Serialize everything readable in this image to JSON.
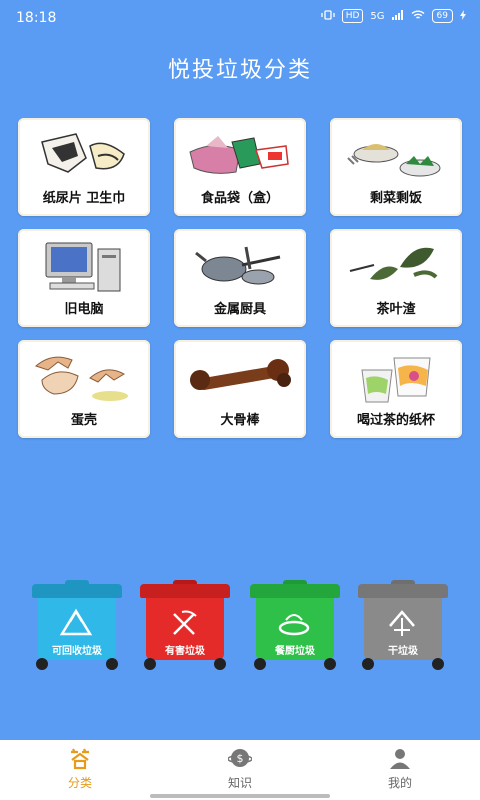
{
  "status_bar": {
    "time": "18:18",
    "network_badge": "HD",
    "signal_text": "5G",
    "battery_text": "69"
  },
  "page": {
    "title": "悦投垃圾分类"
  },
  "items": [
    {
      "label": "纸尿片 卫生巾",
      "icon": "diaper-image"
    },
    {
      "label": "食品袋（盒）",
      "icon": "food-bag-image"
    },
    {
      "label": "剩菜剩饭",
      "icon": "leftover-food-image"
    },
    {
      "label": "旧电脑",
      "icon": "old-computer-image"
    },
    {
      "label": "金属厨具",
      "icon": "metal-cookware-image"
    },
    {
      "label": "茶叶渣",
      "icon": "tea-leaves-image"
    },
    {
      "label": "蛋壳",
      "icon": "eggshell-image"
    },
    {
      "label": "大骨棒",
      "icon": "bone-image"
    },
    {
      "label": "喝过茶的纸杯",
      "icon": "paper-cup-image"
    }
  ],
  "bins": [
    {
      "label": "可回收垃圾",
      "color": "#2fb8e8",
      "icon": "recycle-icon"
    },
    {
      "label": "有害垃圾",
      "color": "#e52a2a",
      "icon": "hazard-icon"
    },
    {
      "label": "餐厨垃圾",
      "color": "#2fc04a",
      "icon": "kitchen-waste-icon"
    },
    {
      "label": "干垃圾",
      "color": "#8a8a8a",
      "icon": "dry-waste-icon"
    }
  ],
  "tabs": [
    {
      "label": "分类",
      "icon": "answer-icon",
      "active": true,
      "accent": "#e89a1a"
    },
    {
      "label": "知识",
      "icon": "knowledge-icon",
      "active": false
    },
    {
      "label": "我的",
      "icon": "profile-icon",
      "active": false
    }
  ]
}
